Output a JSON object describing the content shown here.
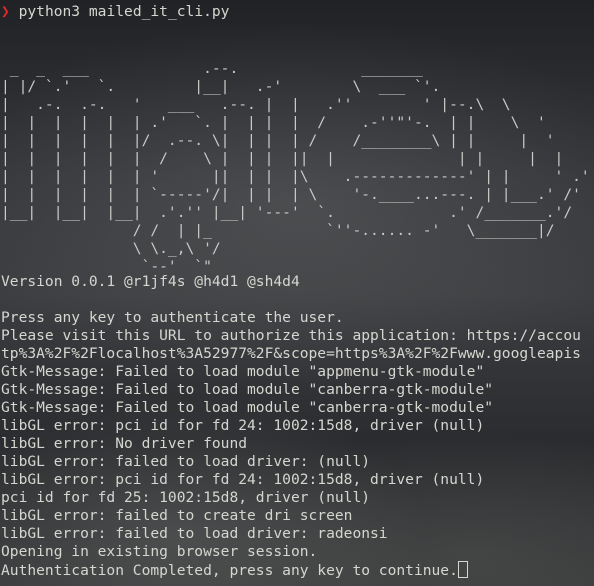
{
  "prompt": {
    "symbol": "❯",
    "command": "python3 mailed_it_cli.py"
  },
  "banner_ascii": " _  _  ___             .--.              _______\n| |/ `.'   `.         |__|   .-'        \\  ___ `'.\n|   .-.  .-.   '   ___   .--. |  |   .''        ' |--.\\  \\\n|  |  |  |  |  | .'   `. |  | |  |  /    .-''\"'-.  | |    \\  '\n|  |  |  |  |  |/  .--. \\|  | |  | /    /________\\ | |     |  '\n|  |  |  |  |  |  /    \\ |  | |  ||  |              | |     |  |\n|  |  |  |  |  | '      ||  | |  |\\    .-------------' | |     ' .'\n|  |  |  |  |  | `-----'/|  | |  | \\    '-.____...---. | |___.' /'\n|__|  |__|  |__|  .'.'' |__| '---'  `.             .' /_______.'/\n               / /  | |_             `''-...... -'   \\_______|/\n               \\ \\._,\\ '/\n                `--'  `\"",
  "version_line": "Version 0.0.1 @r1jf4s @h4d1 @sh4d4",
  "output_lines": [
    "Press any key to authenticate the user.",
    "Please visit this URL to authorize this application: https://accou",
    "tp%3A%2F%2Flocalhost%3A52977%2F&scope=https%3A%2F%2Fwww.googleapis",
    "Gtk-Message: Failed to load module \"appmenu-gtk-module\"",
    "Gtk-Message: Failed to load module \"canberra-gtk-module\"",
    "Gtk-Message: Failed to load module \"canberra-gtk-module\"",
    "libGL error: pci id for fd 24: 1002:15d8, driver (null)",
    "libGL error: No driver found",
    "libGL error: failed to load driver: (null)",
    "libGL error: pci id for fd 24: 1002:15d8, driver (null)",
    "pci id for fd 25: 1002:15d8, driver (null)",
    "libGL error: failed to create dri screen",
    "libGL error: failed to load driver: radeonsi",
    "Opening in existing browser session.",
    "Authentication Completed, press any key to continue."
  ],
  "colors": {
    "prompt_symbol": "#e0282b",
    "text": "#d6d6d0",
    "background": "#1d1f23"
  }
}
